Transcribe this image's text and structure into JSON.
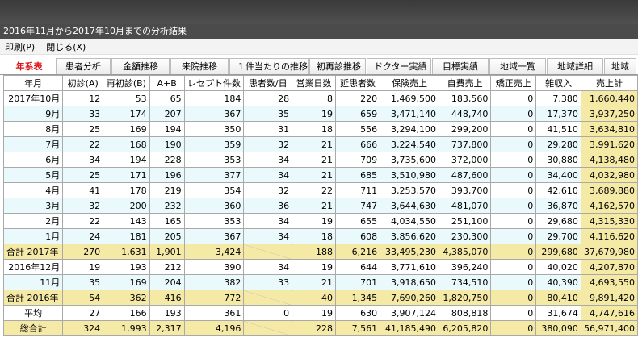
{
  "window": {
    "title": "2016年11月から2017年10月までの分析結果"
  },
  "menu": {
    "print": "印刷(P)",
    "close": "閉じる(X)"
  },
  "tabs": [
    "年系表",
    "患者分析",
    "金額推移",
    "来院推移",
    "１件当たりの推移",
    "初再診推移",
    "ドクター実績",
    "目標実績",
    "地域一覧",
    "地域詳細",
    "地域"
  ],
  "active_tab": "年系表",
  "table": {
    "headers": [
      "年月",
      "初診(A)",
      "再初診(B)",
      "A+B",
      "レセプト件数",
      "患者数/日",
      "営業日数",
      "延患者数",
      "保険売上",
      "自費売上",
      "矯正売上",
      "雑収入",
      "売上計"
    ],
    "rows": [
      {
        "type": "plain",
        "cells": [
          "2017年10月",
          "12",
          "53",
          "65",
          "184",
          "28",
          "8",
          "220",
          "1,469,500",
          "183,560",
          "0",
          "7,380",
          "1,660,440"
        ]
      },
      {
        "type": "alt",
        "cells": [
          "9月",
          "33",
          "174",
          "207",
          "367",
          "35",
          "19",
          "659",
          "3,471,140",
          "448,740",
          "0",
          "17,370",
          "3,937,250"
        ]
      },
      {
        "type": "plain",
        "cells": [
          "8月",
          "25",
          "169",
          "194",
          "350",
          "31",
          "18",
          "556",
          "3,294,100",
          "299,200",
          "0",
          "41,510",
          "3,634,810"
        ]
      },
      {
        "type": "alt",
        "cells": [
          "7月",
          "22",
          "168",
          "190",
          "359",
          "32",
          "21",
          "666",
          "3,224,540",
          "737,800",
          "0",
          "29,280",
          "3,991,620"
        ]
      },
      {
        "type": "plain",
        "cells": [
          "6月",
          "34",
          "194",
          "228",
          "353",
          "34",
          "21",
          "709",
          "3,735,600",
          "372,000",
          "0",
          "30,880",
          "4,138,480"
        ]
      },
      {
        "type": "alt",
        "cells": [
          "5月",
          "25",
          "171",
          "196",
          "377",
          "34",
          "21",
          "685",
          "3,510,980",
          "487,600",
          "0",
          "34,400",
          "4,032,980"
        ]
      },
      {
        "type": "plain",
        "cells": [
          "4月",
          "41",
          "178",
          "219",
          "354",
          "32",
          "22",
          "711",
          "3,253,570",
          "393,700",
          "0",
          "42,610",
          "3,689,880"
        ]
      },
      {
        "type": "alt",
        "cells": [
          "3月",
          "32",
          "200",
          "232",
          "360",
          "36",
          "21",
          "747",
          "3,644,630",
          "481,070",
          "0",
          "36,870",
          "4,162,570"
        ]
      },
      {
        "type": "plain",
        "cells": [
          "2月",
          "22",
          "143",
          "165",
          "353",
          "34",
          "19",
          "655",
          "4,034,550",
          "251,100",
          "0",
          "29,680",
          "4,315,330"
        ]
      },
      {
        "type": "alt",
        "cells": [
          "1月",
          "24",
          "181",
          "205",
          "367",
          "34",
          "18",
          "608",
          "3,856,620",
          "230,300",
          "0",
          "29,700",
          "4,116,620"
        ]
      },
      {
        "type": "total",
        "cells": [
          "合計 2017年",
          "270",
          "1,631",
          "1,901",
          "3,424",
          "",
          "188",
          "6,216",
          "33,495,230",
          "4,385,070",
          "0",
          "299,680",
          "37,679,980"
        ]
      },
      {
        "type": "plain",
        "cells": [
          "2016年12月",
          "19",
          "193",
          "212",
          "390",
          "34",
          "19",
          "644",
          "3,771,610",
          "396,240",
          "0",
          "40,020",
          "4,207,870"
        ]
      },
      {
        "type": "alt",
        "cells": [
          "11月",
          "35",
          "169",
          "204",
          "382",
          "33",
          "21",
          "701",
          "3,918,650",
          "734,510",
          "0",
          "40,390",
          "4,693,550"
        ]
      },
      {
        "type": "total",
        "cells": [
          "合計 2016年",
          "54",
          "362",
          "416",
          "772",
          "",
          "40",
          "1,345",
          "7,690,260",
          "1,820,750",
          "0",
          "80,410",
          "9,891,420"
        ]
      },
      {
        "type": "plain",
        "cells": [
          "平均",
          "27",
          "166",
          "193",
          "361",
          "0",
          "19",
          "630",
          "3,907,124",
          "808,818",
          "0",
          "31,674",
          "4,747,616"
        ]
      },
      {
        "type": "total",
        "cells": [
          "総合計",
          "324",
          "1,993",
          "2,317",
          "4,196",
          "",
          "228",
          "7,561",
          "41,185,490",
          "6,205,820",
          "0",
          "380,090",
          "56,971,400"
        ]
      }
    ]
  },
  "colors": {
    "alt_row": "#eaf9fb",
    "total_row": "#f5e9a6",
    "active_tab_text": "#dd1111"
  }
}
